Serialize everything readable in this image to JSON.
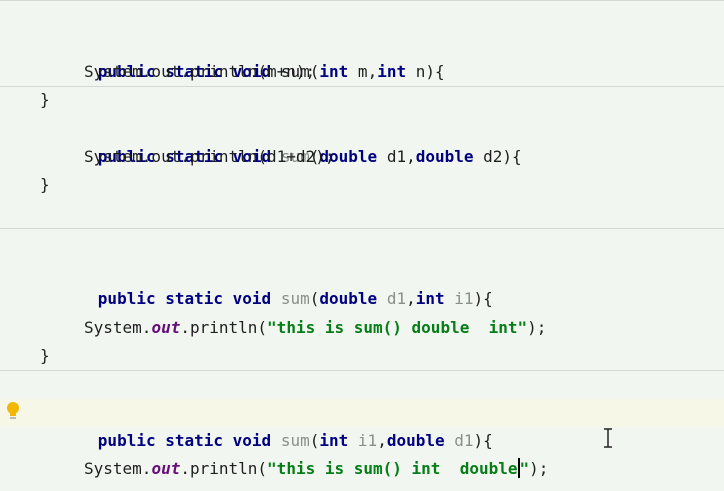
{
  "editor": {
    "blocks": [
      {
        "signature": {
          "modifiers": "public static void",
          "method": "sum",
          "params": [
            {
              "type": "int",
              "name": "m"
            },
            {
              "type": "int",
              "name": "n"
            }
          ]
        },
        "body": "System.out.println(m+n);",
        "close": "}"
      },
      {
        "signature": {
          "modifiers": "public static void",
          "method": "sum",
          "params": [
            {
              "type": "double",
              "name": "d1"
            },
            {
              "type": "double",
              "name": "d2"
            }
          ]
        },
        "body": "System.out.println(d1+d2);",
        "close": "}"
      },
      {
        "signature": {
          "modifiers": "public static void",
          "method": "sum",
          "params": [
            {
              "type": "double",
              "name": "d1"
            },
            {
              "type": "int",
              "name": "i1"
            }
          ]
        },
        "body_prefix": "System.",
        "body_field": "out",
        "body_call": ".println(",
        "body_string": "\"this is sum() double  int\"",
        "body_suffix": ");",
        "close": "}"
      },
      {
        "signature": {
          "modifiers": "public static void",
          "method": "sum",
          "params": [
            {
              "type": "int",
              "name": "i1"
            },
            {
              "type": "double",
              "name": "d1"
            }
          ]
        },
        "body_prefix": "System.",
        "body_field": "out",
        "body_call": ".println(",
        "body_string_before_caret": "\"this is sum() int  double",
        "body_string_after_caret": "\"",
        "body_suffix": ");",
        "close": "}"
      }
    ],
    "punct": {
      "open_paren": "(",
      "comma": ",",
      "close_brace_open": "){",
      "space": " "
    },
    "colors": {
      "keyword": "#000080",
      "string": "#067d17",
      "static_field": "#660e7a",
      "unused": "#8a8f8a",
      "caret_line": "#f7f7e8",
      "bulb": "#f2b705"
    },
    "icons": {
      "intention_bulb": "lightbulb-icon",
      "mouse_cursor": "text-cursor-icon"
    }
  }
}
